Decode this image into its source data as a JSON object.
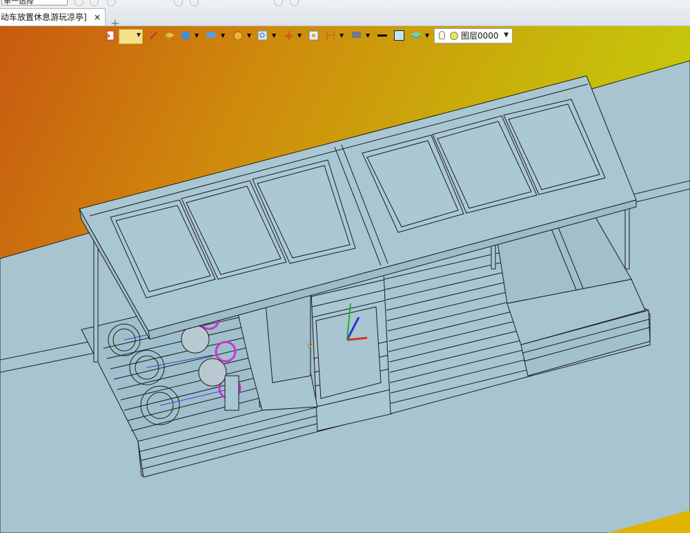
{
  "window": {
    "selection_filter": "单一选择",
    "tab_title": "动车放置休息游玩凉亭]",
    "tab_close_icon": "×",
    "new_tab_icon": "+"
  },
  "toolbar": {
    "icons": [
      "exit-sketch-icon",
      "pick-mode-icon",
      "pen-icon",
      "shaded-box-icon",
      "cube-view-icon",
      "render-mode-icon",
      "display-filter-icon",
      "zoom-fit-icon",
      "axis-origin-icon",
      "grid-icon",
      "dimension-icon",
      "monitor-icon",
      "line-style-icon",
      "color-swatch-icon",
      "layers-icon"
    ],
    "layer": {
      "name": "图层0000",
      "dropdown_icon": "▼"
    }
  },
  "colors": {
    "background_top_left": "#c85a10",
    "background_top_right": "#c3e20a",
    "ground": "#a7c4d0",
    "model_fill": "#a9c7d3",
    "model_edge": "#1a1a1a",
    "wheel_accent": "#cc33cc"
  }
}
